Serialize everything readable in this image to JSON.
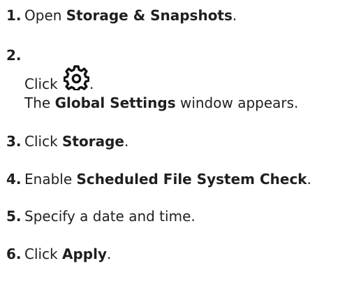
{
  "steps": [
    {
      "number": "1.",
      "text_before": "Open ",
      "emphasis": "Storage & Snapshots",
      "text_after": "."
    },
    {
      "number": "2.",
      "text_before": "Click ",
      "icon": "settings-gear-icon",
      "text_after": ".",
      "line2_before": "The ",
      "line2_emphasis": "Global Settings",
      "line2_after": " window appears."
    },
    {
      "number": "3.",
      "text_before": "Click ",
      "emphasis": "Storage",
      "text_after": "."
    },
    {
      "number": "4.",
      "text_before": "Enable ",
      "emphasis": "Scheduled File System Check",
      "text_after": "."
    },
    {
      "number": "5.",
      "text_before": "Specify a date and time."
    },
    {
      "number": "6.",
      "text_before": "Click ",
      "emphasis": "Apply",
      "text_after": "."
    }
  ]
}
